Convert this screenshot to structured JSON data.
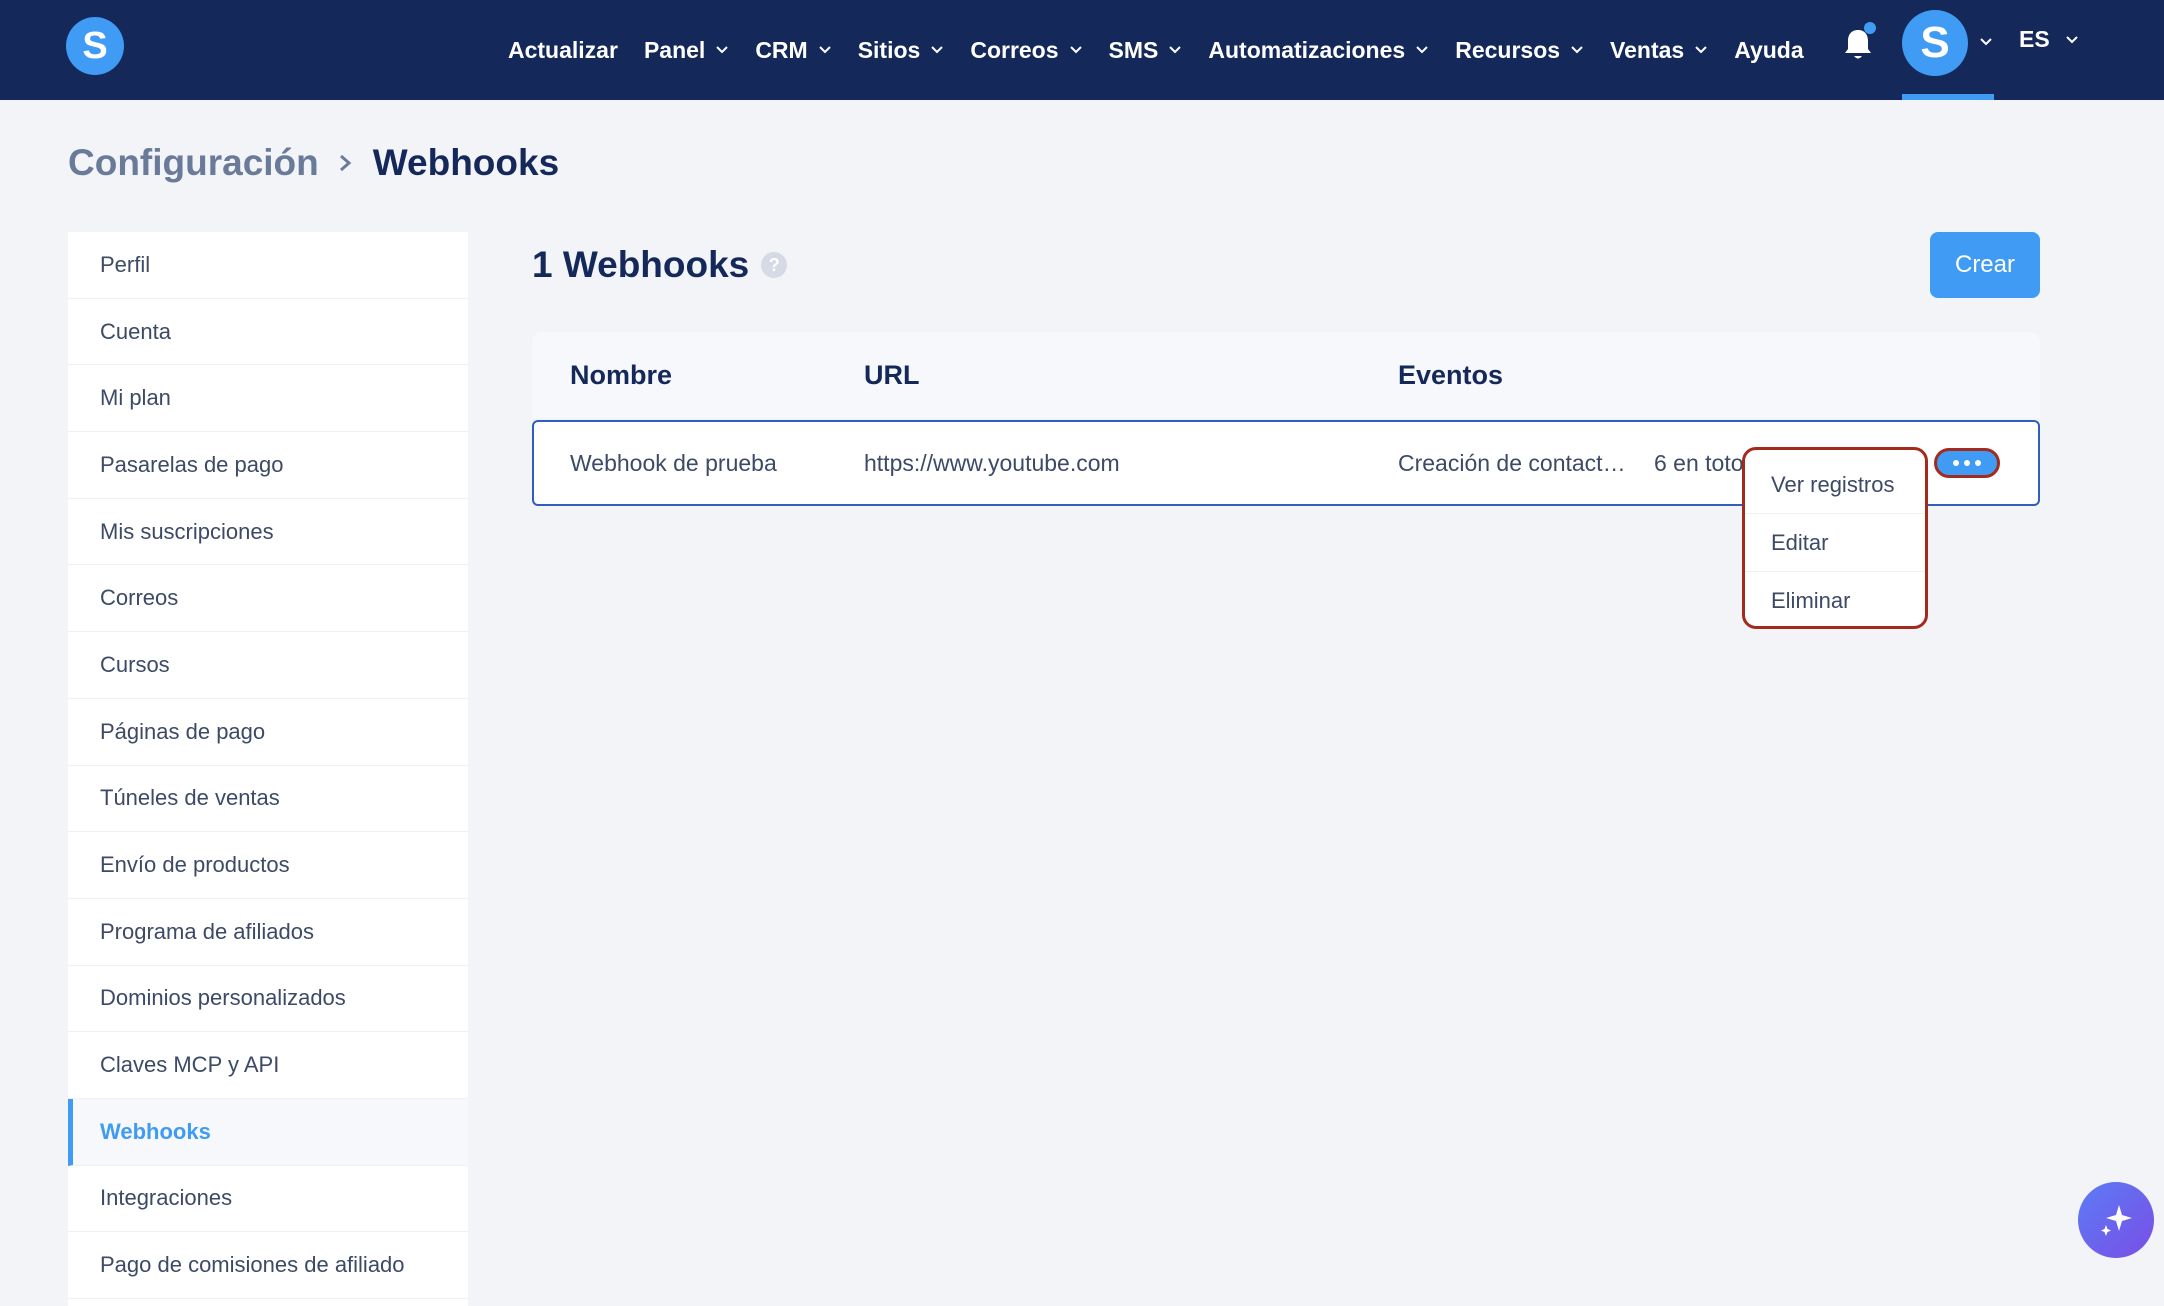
{
  "app": {
    "logo_letter": "S"
  },
  "nav": {
    "items": [
      {
        "label": "Actualizar",
        "dropdown": false
      },
      {
        "label": "Panel",
        "dropdown": true
      },
      {
        "label": "CRM",
        "dropdown": true
      },
      {
        "label": "Sitios",
        "dropdown": true
      },
      {
        "label": "Correos",
        "dropdown": true
      },
      {
        "label": "SMS",
        "dropdown": true
      },
      {
        "label": "Automatizaciones",
        "dropdown": true
      },
      {
        "label": "Recursos",
        "dropdown": true
      },
      {
        "label": "Ventas",
        "dropdown": true
      },
      {
        "label": "Ayuda",
        "dropdown": false
      }
    ],
    "avatar_letter": "S",
    "language": "ES"
  },
  "breadcrumb": {
    "parent": "Configuración",
    "current": "Webhooks"
  },
  "sidebar": {
    "items": [
      {
        "label": "Perfil"
      },
      {
        "label": "Cuenta"
      },
      {
        "label": "Mi plan"
      },
      {
        "label": "Pasarelas de pago"
      },
      {
        "label": "Mis suscripciones"
      },
      {
        "label": "Correos"
      },
      {
        "label": "Cursos"
      },
      {
        "label": "Páginas de pago"
      },
      {
        "label": "Túneles de ventas"
      },
      {
        "label": "Envío de productos"
      },
      {
        "label": "Programa de afiliados"
      },
      {
        "label": "Dominios personalizados"
      },
      {
        "label": "Claves MCP y API"
      },
      {
        "label": "Webhooks",
        "active": true
      },
      {
        "label": "Integraciones"
      },
      {
        "label": "Pago de comisiones de afiliado"
      }
    ]
  },
  "main": {
    "title": "1 Webhooks",
    "help_glyph": "?",
    "create_label": "Crear",
    "table": {
      "headers": {
        "name": "Nombre",
        "url": "URL",
        "events": "Eventos"
      },
      "rows": [
        {
          "name": "Webhook de prueba",
          "url": "https://www.youtube.com",
          "events": "Creación de contact…",
          "events_total": "6 en toto"
        }
      ]
    },
    "row_menu": {
      "items": [
        "Ver registros",
        "Editar",
        "Eliminar"
      ]
    }
  },
  "colors": {
    "nav_bg": "#14285a",
    "accent": "#3f9bf3",
    "highlight_border": "#a32a1d"
  }
}
